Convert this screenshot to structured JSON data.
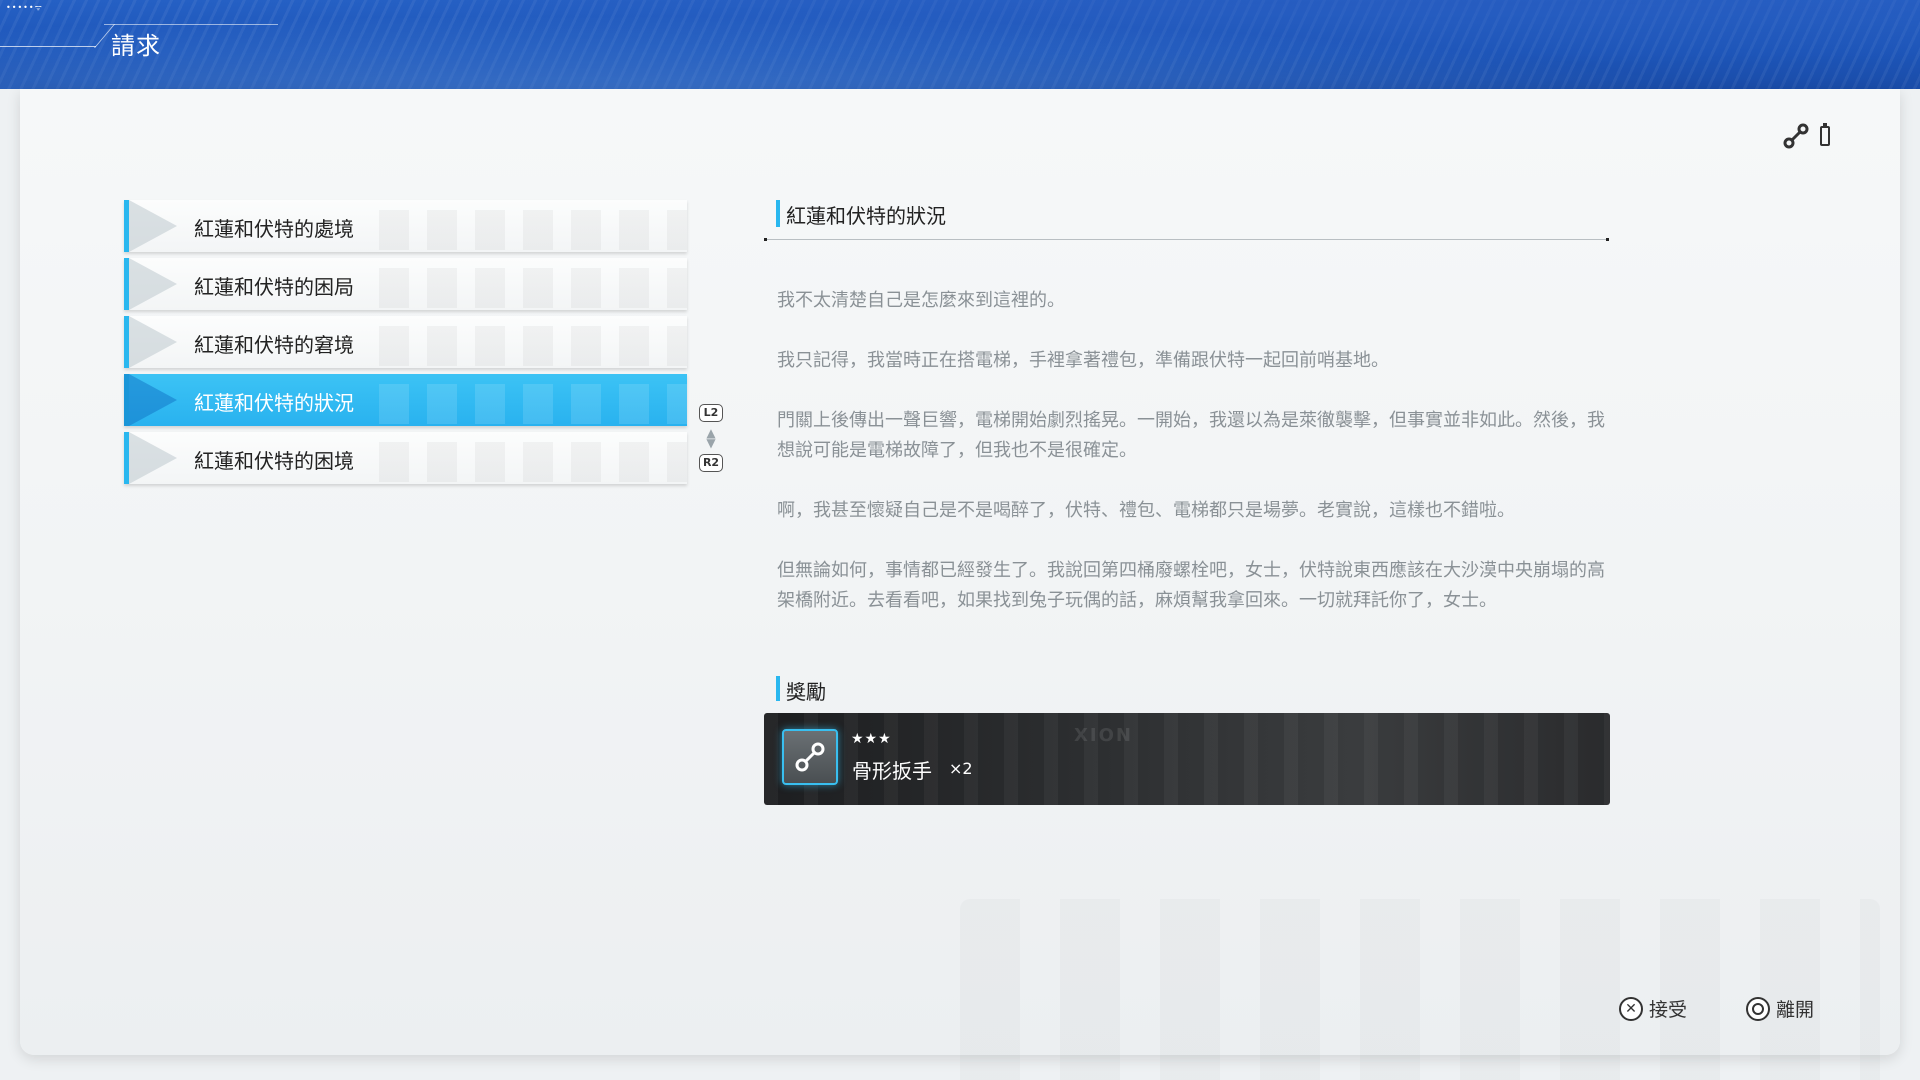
{
  "header": {
    "status_dots": "•••••ᯤ",
    "title": "請求"
  },
  "quests": [
    {
      "label": "紅蓮和伏特的處境",
      "selected": false
    },
    {
      "label": "紅蓮和伏特的困局",
      "selected": false
    },
    {
      "label": "紅蓮和伏特的窘境",
      "selected": false
    },
    {
      "label": "紅蓮和伏特的狀況",
      "selected": true
    },
    {
      "label": "紅蓮和伏特的困境",
      "selected": false
    }
  ],
  "scroll_hint": {
    "up_button": "L2",
    "down_button": "R2"
  },
  "detail": {
    "title": "紅蓮和伏特的狀況",
    "paragraphs": [
      "我不太清楚自己是怎麼來到這裡的。",
      "我只記得，我當時正在搭電梯，手裡拿著禮包，準備跟伏特一起回前哨基地。",
      "門關上後傳出一聲巨響，電梯開始劇烈搖晃。一開始，我還以為是萊徹襲擊，但事實並非如此。然後，我想說可能是電梯故障了，但我也不是很確定。",
      "啊，我甚至懷疑自己是不是喝醉了，伏特、禮包、電梯都只是場夢。老實說，這樣也不錯啦。",
      "但無論如何，事情都已經發生了。我說回第四桶廢螺栓吧，女士，伏特說東西應該在大沙漠中央崩塌的高架橋附近。去看看吧，如果找到兔子玩偶的話，麻煩幫我拿回來。一切就拜託你了，女士。"
    ]
  },
  "reward": {
    "section_title": "獎勵",
    "stars": "★★★",
    "item_name": "骨形扳手",
    "quantity": "×2",
    "watermark": "XION",
    "icon": "wrench-icon"
  },
  "prompts": {
    "accept_label": "接受",
    "leave_label": "離開"
  },
  "colors": {
    "accent": "#29b7ef",
    "banner": "#1d55b8",
    "selected": "#33bcf3"
  }
}
